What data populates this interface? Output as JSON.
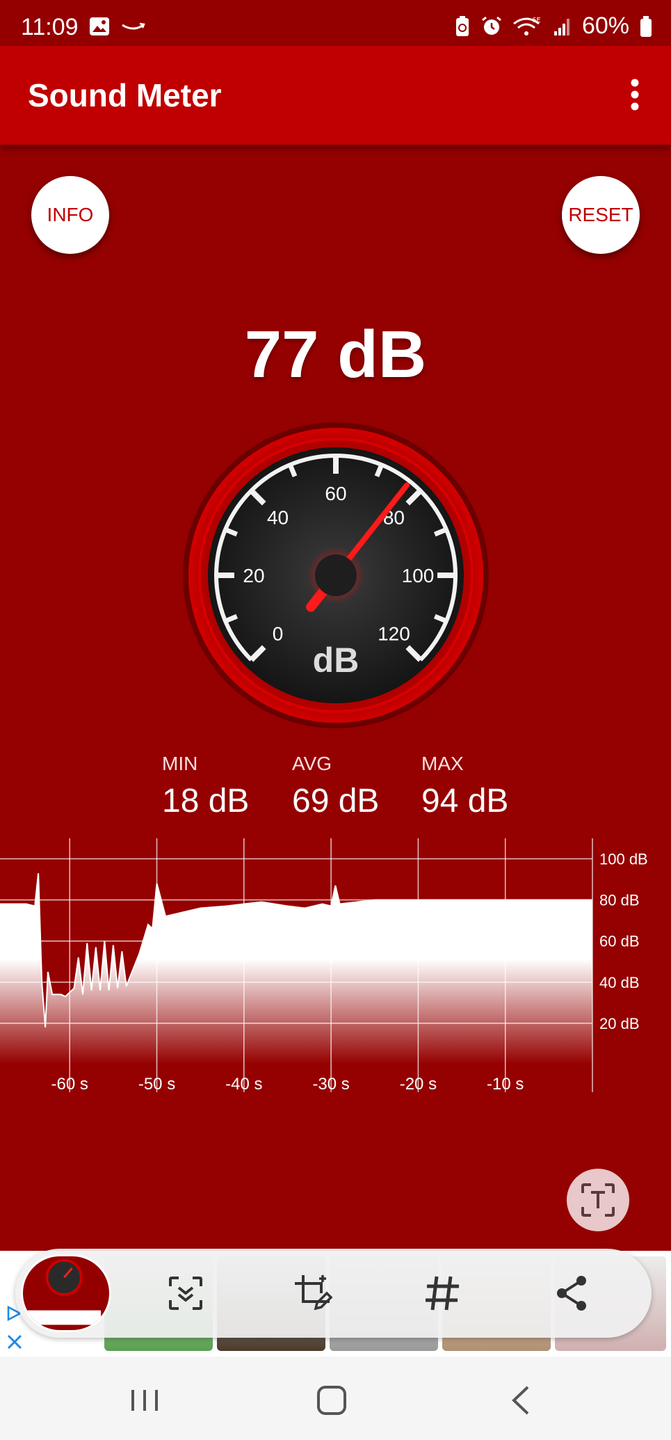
{
  "status_bar": {
    "time": "11:09",
    "battery": "60%"
  },
  "app_bar": {
    "title": "Sound Meter",
    "menu_icon": "more-vert-icon"
  },
  "buttons": {
    "info": "INFO",
    "reset": "RESET"
  },
  "current_level": "77 dB",
  "gauge": {
    "unit": "dB",
    "value": 77,
    "min": 0,
    "max": 120,
    "tick_labels": [
      "0",
      "20",
      "40",
      "60",
      "80",
      "100",
      "120"
    ],
    "needle_color": "#ff1a1a"
  },
  "stats": {
    "min_label": "MIN",
    "min_value": "18 dB",
    "avg_label": "AVG",
    "avg_value": "69 dB",
    "max_label": "MAX",
    "max_value": "94 dB"
  },
  "chart_data": {
    "type": "area",
    "x_tick_labels": [
      "-60 s",
      "-50 s",
      "-40 s",
      "-30 s",
      "-20 s",
      "-10 s"
    ],
    "y_tick_labels": [
      "100 dB",
      "80 dB",
      "60 dB",
      "40 dB",
      "20 dB"
    ],
    "x_range": [
      -68,
      0
    ],
    "y_range": [
      0,
      110
    ],
    "x": [
      -68,
      -65,
      -64,
      -63.6,
      -63.2,
      -62.8,
      -62.5,
      -62,
      -61,
      -60.5,
      -59.5,
      -59,
      -58.5,
      -58,
      -57.5,
      -57,
      -56.5,
      -56,
      -55.5,
      -55,
      -54.5,
      -54,
      -53.5,
      -52,
      -51,
      -50.5,
      -50,
      -49,
      -47,
      -45,
      -42,
      -40,
      -38,
      -35,
      -33,
      -31,
      -30,
      -29.5,
      -29,
      -27,
      -25,
      -20,
      -15,
      -10,
      -5,
      -2,
      0
    ],
    "y": [
      78,
      78,
      77,
      93,
      40,
      18,
      45,
      34,
      34,
      33,
      37,
      52,
      34,
      59,
      36,
      57,
      36,
      60,
      36,
      58,
      37,
      55,
      38,
      54,
      68,
      66,
      88,
      72,
      74,
      76,
      77,
      78,
      79,
      77,
      76,
      78,
      77,
      87,
      78,
      79,
      80,
      80,
      80,
      80,
      80,
      80,
      80
    ],
    "grid": true,
    "line_color": "#ffffff"
  },
  "ad": {
    "play_icon": "ad-choices-icon",
    "close_icon": "close-icon"
  },
  "toolbar": {
    "thumbnail": "screenshot-thumbnail",
    "scroll_capture_icon": "scroll-capture-icon",
    "crop_edit_icon": "crop-edit-icon",
    "tag_icon": "hashtag-icon",
    "share_icon": "share-icon"
  },
  "nav": {
    "recents_icon": "recents-icon",
    "home_icon": "home-icon",
    "back_icon": "back-icon"
  }
}
